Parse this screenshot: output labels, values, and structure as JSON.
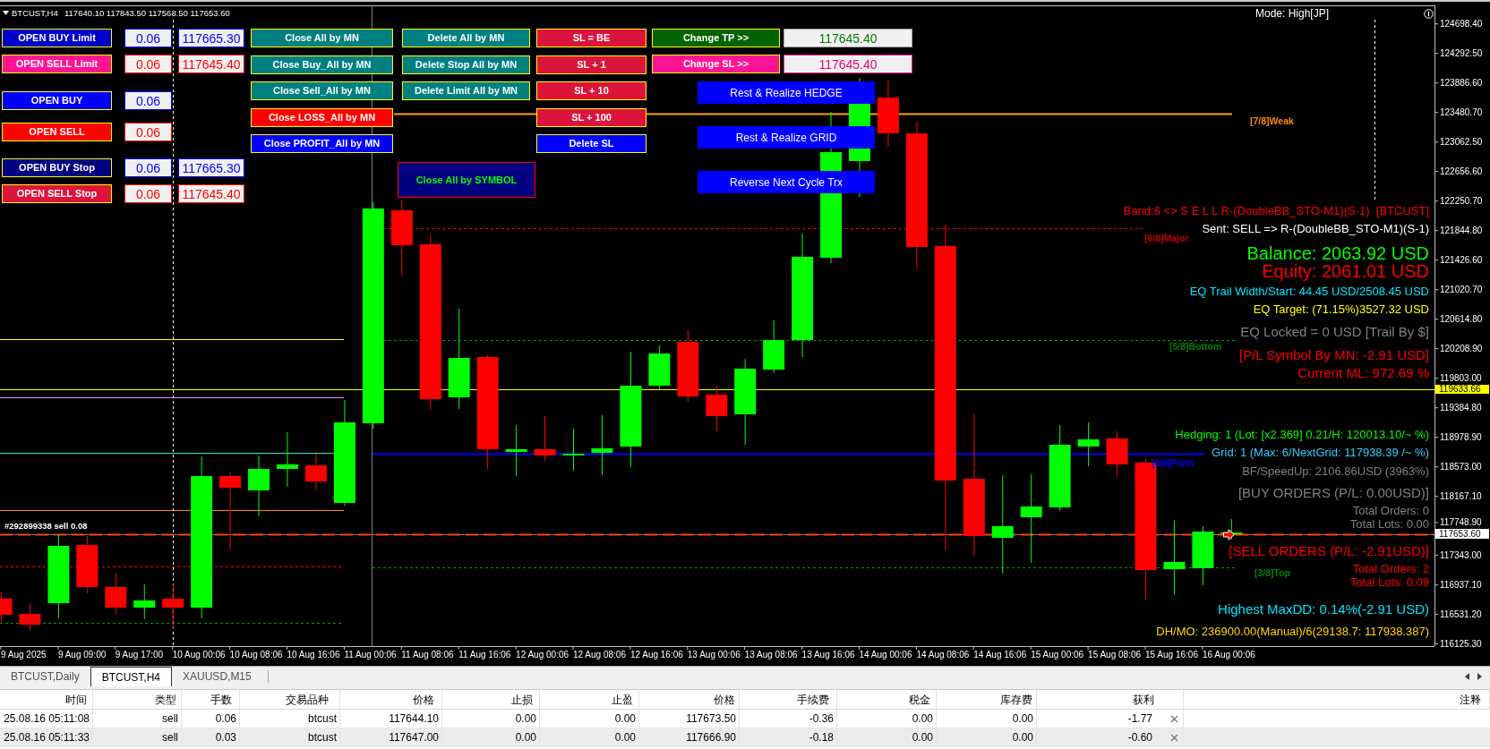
{
  "chart": {
    "title": "BTCUST,H4",
    "ohlc": "117640.10 117843.50 117568.50 117653.60",
    "mode": "Mode: High[JP]",
    "order_label": "#292899338 sell 0.08"
  },
  "order_panel": [
    {
      "label": "OPEN BUY Limit",
      "color": "#0000cd",
      "kind": "buy",
      "lot": "0.06",
      "price": "117665.30"
    },
    {
      "label": "OPEN SELL Limit",
      "color": "#ff1493",
      "kind": "sell",
      "lot": "0.06",
      "price": "117645.40"
    },
    {
      "label": "OPEN BUY",
      "color": "#0000ff",
      "kind": "buy",
      "lot": "0.06"
    },
    {
      "label": "OPEN SELL",
      "color": "#ff0000",
      "kind": "sell",
      "lot": "0.06"
    },
    {
      "label": "OPEN BUY Stop",
      "color": "#000080",
      "kind": "buy",
      "lot": "0.06",
      "price": "117665.30"
    },
    {
      "label": "OPEN SELL Stop",
      "color": "#dc143c",
      "kind": "sell",
      "lot": "0.06",
      "price": "117645.40"
    }
  ],
  "close_buttons": [
    {
      "label": "Close All by MN",
      "color": "#008080"
    },
    {
      "label": "Close Buy_All by MN",
      "color": "#008080"
    },
    {
      "label": "Close Sell_All by MN",
      "color": "#008080"
    },
    {
      "label": "Close LOSS_All by MN",
      "color": "#ff0000"
    },
    {
      "label": "Close PROFIT_All by MN",
      "color": "#0000ff"
    }
  ],
  "delete_buttons": [
    {
      "label": "Delete All by MN"
    },
    {
      "label": "Delete Stop All by MN"
    },
    {
      "label": "Delete Limit All by MN"
    }
  ],
  "sl_buttons": [
    {
      "label": "SL = BE",
      "color": "#dc143c"
    },
    {
      "label": "SL + 1",
      "color": "#dc143c"
    },
    {
      "label": "SL + 10",
      "color": "#dc143c"
    },
    {
      "label": "SL + 100",
      "color": "#dc143c"
    },
    {
      "label": "Delete SL",
      "color": "#0000ff"
    }
  ],
  "modify_rows": [
    {
      "label": "Change TP >>",
      "color": "#006400",
      "kind": "tp",
      "value": "117645.40"
    },
    {
      "label": "Change SL >>",
      "color": "#ff1493",
      "kind": "sl",
      "value": "117645.40"
    }
  ],
  "symbol_button": {
    "label": "Close All by SYMBOL"
  },
  "action_buttons": [
    {
      "label": "Rest & Realize HEDGE"
    },
    {
      "label": "Rest & Realize GRID"
    },
    {
      "label": "Reverse Next Cycle Trx"
    }
  ],
  "level_labels": [
    {
      "text": "[7/8]Weak",
      "color": "#ff8c00"
    },
    {
      "text": "[6/8]Major",
      "color": "#c00000"
    },
    {
      "text": "[5/8]Bottom",
      "color": "#008000"
    },
    {
      "text": "[4/8]Pivot",
      "color": "#0000ff"
    },
    {
      "text": "[3/8]Top",
      "color": "#008000"
    }
  ],
  "info_panel": [
    {
      "text": "Band:6 <> S E L L R-(DoubleBB_STO-M1)(S-1)  [BTCUST]",
      "color": "#ff0000",
      "kind": "detail"
    },
    {
      "text": "Sent: SELL => R-(DoubleBB_STO-M1)(S-1)",
      "color": "#ffffff",
      "kind": "detail"
    },
    {
      "text": "Balance: 2063.92 USD",
      "color": "#00ff00",
      "kind": "headline"
    },
    {
      "text": "Equity: 2061.01 USD",
      "color": "#ff0000",
      "kind": "headline"
    },
    {
      "text": "EQ Trail Width/Start: 44.45 USD/2508.45 USD",
      "color": "#00e5ff",
      "kind": "detail"
    },
    {
      "text": "EQ Target: (71.15%)3527.32 USD",
      "color": "#ffff00",
      "kind": "detail"
    },
    {
      "text": "EQ Locked = 0 USD [Trail By $]",
      "color": "#808080",
      "kind": "heading"
    },
    {
      "text": "[P/L Symbol By MN: -2.91 USD]",
      "color": "#ff0000",
      "kind": "heading"
    },
    {
      "text": "Current ML: 972.69 %",
      "color": "#ff0000",
      "kind": "heading"
    },
    {
      "text": "Hedging: 1 (Lot: [x2.369] 0.21/H: 120013.10/~ %)",
      "color": "#00ff00",
      "kind": "detail"
    },
    {
      "text": "Grid: 1 (Max: 6/NextGrid: 117938.39 /~ %)",
      "color": "#33ccff",
      "kind": "detail"
    },
    {
      "text": "BF/SpeedUp: 2106.86USD (3963%)",
      "color": "#808080",
      "kind": "detail"
    },
    {
      "text": "[BUY ORDERS (P/L: 0.00USD)]",
      "color": "#808080",
      "kind": "heading"
    },
    {
      "text": "Total Orders: 0",
      "color": "#808080",
      "kind": "detail"
    },
    {
      "text": "Total Lots: 0.00",
      "color": "#808080",
      "kind": "detail"
    },
    {
      "text": "[SELL ORDERS (P/L: -2.91USD)]",
      "color": "#ff0000",
      "kind": "heading"
    },
    {
      "text": "Total Orders: 2",
      "color": "#ff0000",
      "kind": "detail"
    },
    {
      "text": "Total Lots: 0.09",
      "color": "#ff0000",
      "kind": "detail"
    },
    {
      "text": "Highest MaxDD: 0.14%(-2.91 USD)",
      "color": "#00e5ff",
      "kind": "heading"
    },
    {
      "text": "DH/MO: 236900.00(Manual)/6(29138.7: 117938.387)",
      "color": "#ffd700",
      "kind": "detail"
    }
  ],
  "price_axis": {
    "labels": [
      "124698.40",
      "124292.50",
      "123886.60",
      "123480.70",
      "123062.50",
      "122656.60",
      "122250.70",
      "121844.80",
      "121426.60",
      "121020.70",
      "120614.80",
      "120208.90",
      "119803.00",
      "119384.80",
      "118978.90",
      "118573.00",
      "118167.10",
      "117748.90",
      "117343.00",
      "116937.10",
      "116531.20",
      "116125.30"
    ],
    "line_label": "119633.66",
    "bid_label": "117653.60"
  },
  "time_axis": {
    "labels": [
      "9 Aug 2025",
      "9 Aug 09:00",
      "9 Aug 17:00",
      "10 Aug 00:06",
      "10 Aug 08:06",
      "10 Aug 16:06",
      "11 Aug 00:06",
      "11 Aug 08:06",
      "11 Aug 16:06",
      "12 Aug 00:06",
      "12 Aug 08:06",
      "12 Aug 16:06",
      "13 Aug 00:06",
      "13 Aug 08:06",
      "13 Aug 16:06",
      "14 Aug 00:06",
      "14 Aug 08:06",
      "14 Aug 16:06",
      "15 Aug 00:06",
      "15 Aug 08:06",
      "15 Aug 16:06",
      "16 Aug 00:06"
    ]
  },
  "chart_tabs": [
    {
      "label": "BTCUST,Daily",
      "selected": false
    },
    {
      "label": "BTCUST,H4",
      "selected": true
    },
    {
      "label": "XAUUSD,M15",
      "selected": false
    }
  ],
  "trade_table": {
    "columns": [
      "时间",
      "类型",
      "手数",
      "交易品种",
      "价格",
      "止损",
      "止盈",
      "价格",
      "手续费",
      "税金",
      "库存费",
      "获利",
      "注释"
    ],
    "rows": [
      {
        "cells": [
          "25.08.16 05:11:08",
          "sell",
          "0.06",
          "btcust",
          "117644.10",
          "0.00",
          "0.00",
          "117673.50",
          "-0.36",
          "0.00",
          "0.00",
          "-1.77"
        ]
      },
      {
        "cells": [
          "25.08.16 05:11:33",
          "sell",
          "0.03",
          "btcust",
          "117647.00",
          "0.00",
          "0.00",
          "117666.90",
          "-0.18",
          "0.00",
          "0.00",
          "-0.60"
        ]
      }
    ]
  }
}
